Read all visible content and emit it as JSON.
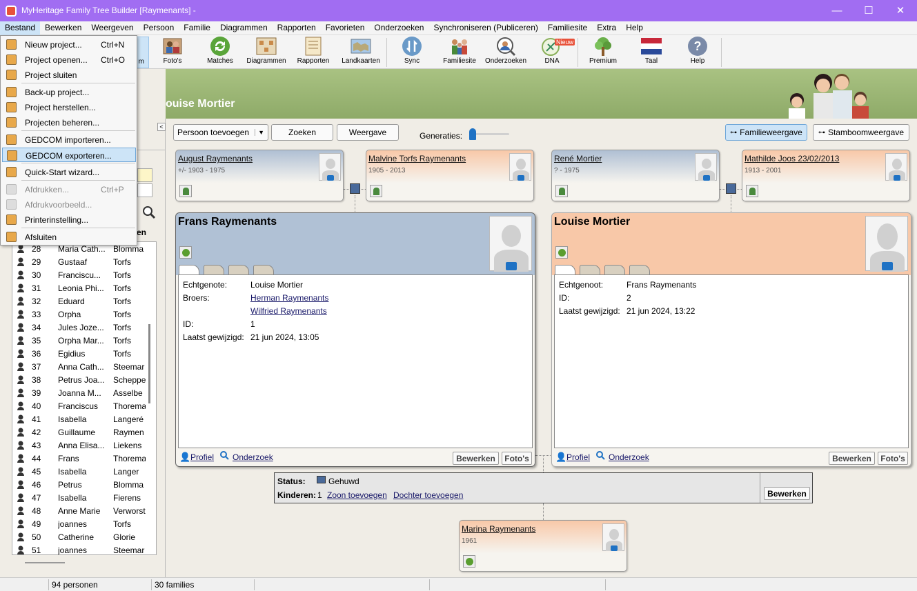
{
  "window": {
    "title": "MyHeritage Family Tree Builder [Raymenants] -",
    "minimize": "—",
    "maximize": "☐",
    "close": "✕"
  },
  "menubar": [
    "Bestand",
    "Bewerken",
    "Weergeven",
    "Persoon",
    "Familie",
    "Diagrammen",
    "Rapporten",
    "Favorieten",
    "Onderzoeken",
    "Synchroniseren (Publiceren)",
    "Familiesite",
    "Extra",
    "Help"
  ],
  "toolbar": {
    "items": [
      {
        "label": "m",
        "icon": "project-icon"
      },
      {
        "label": "Foto's",
        "icon": "photos-icon"
      },
      {
        "label": "Matches",
        "icon": "matches-icon"
      },
      {
        "label": "Diagrammen",
        "icon": "charts-icon"
      },
      {
        "label": "Rapporten",
        "icon": "reports-icon"
      },
      {
        "label": "Landkaarten",
        "icon": "maps-icon"
      },
      {
        "label": "Sync",
        "icon": "sync-icon"
      },
      {
        "label": "Familiesite",
        "icon": "familysite-icon"
      },
      {
        "label": "Onderzoeken",
        "icon": "research-icon"
      },
      {
        "label": "DNA",
        "icon": "dna-icon",
        "badge": "Nieuw"
      },
      {
        "label": "Premium",
        "icon": "premium-icon"
      },
      {
        "label": "Taal",
        "icon": "language-flag-icon"
      },
      {
        "label": "Help",
        "icon": "help-icon"
      }
    ]
  },
  "banner": {
    "name": "ouise Mortier"
  },
  "filemenu": {
    "items": [
      {
        "label": "Nieuw project...",
        "shortcut": "Ctrl+N",
        "icon": "new-project-icon",
        "disabled": false
      },
      {
        "label": "Project openen...",
        "shortcut": "Ctrl+O",
        "icon": "open-project-icon",
        "disabled": false
      },
      {
        "label": "Project sluiten",
        "shortcut": "",
        "icon": "close-project-icon",
        "disabled": false
      },
      {
        "label": "Back-up project...",
        "shortcut": "",
        "icon": "backup-icon",
        "disabled": false
      },
      {
        "label": "Project herstellen...",
        "shortcut": "",
        "icon": "restore-icon",
        "disabled": false
      },
      {
        "label": "Projecten beheren...",
        "shortcut": "",
        "icon": "manage-projects-icon",
        "disabled": false
      },
      {
        "label": "GEDCOM importeren...",
        "shortcut": "",
        "icon": "gedcom-import-icon",
        "disabled": false
      },
      {
        "label": "GEDCOM exporteren...",
        "shortcut": "",
        "icon": "gedcom-export-icon",
        "disabled": false,
        "highlighted": true
      },
      {
        "label": "Quick-Start wizard...",
        "shortcut": "",
        "icon": "wizard-icon",
        "disabled": false
      },
      {
        "label": "Afdrukken...",
        "shortcut": "Ctrl+P",
        "icon": "print-icon",
        "disabled": true
      },
      {
        "label": "Afdrukvoorbeeld...",
        "shortcut": "",
        "icon": "print-preview-icon",
        "disabled": true
      },
      {
        "label": "Printerinstelling...",
        "shortcut": "",
        "icon": "printer-setup-icon",
        "disabled": false
      },
      {
        "label": "Afsluiten",
        "shortcut": "",
        "icon": "exit-icon",
        "disabled": false
      }
    ]
  },
  "leftpanel": {
    "collapse": "<",
    "header_frag": "en",
    "rows": [
      {
        "id": "28",
        "first": "Maria Cath...",
        "last": "Blomma"
      },
      {
        "id": "29",
        "first": "Gustaaf",
        "last": "Torfs"
      },
      {
        "id": "30",
        "first": "Franciscu...",
        "last": "Torfs"
      },
      {
        "id": "31",
        "first": "Leonia Phi...",
        "last": "Torfs"
      },
      {
        "id": "32",
        "first": "Eduard",
        "last": "Torfs"
      },
      {
        "id": "33",
        "first": "Orpha",
        "last": "Torfs"
      },
      {
        "id": "34",
        "first": "Jules Joze...",
        "last": "Torfs"
      },
      {
        "id": "35",
        "first": "Orpha Mar...",
        "last": "Torfs"
      },
      {
        "id": "36",
        "first": "Egidius",
        "last": "Torfs"
      },
      {
        "id": "37",
        "first": "Anna Cath...",
        "last": "Steemar"
      },
      {
        "id": "38",
        "first": "Petrus Joa...",
        "last": "Scheppe"
      },
      {
        "id": "39",
        "first": "Joanna M...",
        "last": "Asselbe"
      },
      {
        "id": "40",
        "first": "Franciscus",
        "last": "Thorema"
      },
      {
        "id": "41",
        "first": "Isabella",
        "last": "Langeré"
      },
      {
        "id": "42",
        "first": "Guillaume",
        "last": "Raymen"
      },
      {
        "id": "43",
        "first": "Anna Elisa...",
        "last": "Liekens"
      },
      {
        "id": "44",
        "first": "Frans",
        "last": "Thorema"
      },
      {
        "id": "45",
        "first": "Isabella",
        "last": "Langer"
      },
      {
        "id": "46",
        "first": "Petrus",
        "last": "Blomma"
      },
      {
        "id": "47",
        "first": "Isabella",
        "last": "Fierens"
      },
      {
        "id": "48",
        "first": "Anne Marie",
        "last": "Verworst"
      },
      {
        "id": "49",
        "first": "joannes",
        "last": "Torfs"
      },
      {
        "id": "50",
        "first": "Catherine",
        "last": "Glorie"
      },
      {
        "id": "51",
        "first": "joannes",
        "last": "Steemar"
      }
    ]
  },
  "actionbar": {
    "add_person": "Persoon toevoegen",
    "search": "Zoeken",
    "view": "Weergave",
    "generations": "Generaties:",
    "family_view": "Familieweergave",
    "tree_view": "Stamboomweergave"
  },
  "parents": [
    {
      "name": "August Raymenants",
      "dates": "+/- 1903 - 1975"
    },
    {
      "name": "Malvine Torfs Raymenants",
      "dates": "1905 - 2013"
    },
    {
      "name": "René Mortier",
      "dates": "? - 1975"
    },
    {
      "name": "Mathilde Joos 23/02/2013",
      "dates": "1913 - 2001"
    }
  ],
  "husband": {
    "name": "Frans Raymenants",
    "fields": [
      {
        "label": "Echtgenote:",
        "value": "Louise Mortier",
        "link": false
      },
      {
        "label": "Broers:",
        "value": "Herman Raymenants",
        "link": true
      },
      {
        "label": "",
        "value": "Wilfried Raymenants",
        "link": true
      },
      {
        "label": "ID:",
        "value": "1",
        "link": false
      },
      {
        "label": "Laatst gewijzigd:",
        "value": "21 jun 2024, 13:05",
        "link": false
      }
    ]
  },
  "wife": {
    "name": "Louise Mortier",
    "fields": [
      {
        "label": "Echtgenoot:",
        "value": "Frans Raymenants",
        "link": false
      },
      {
        "label": "ID:",
        "value": "2",
        "link": false
      },
      {
        "label": "Laatst gewijzigd:",
        "value": "21 jun 2024, 13:22",
        "link": false
      }
    ]
  },
  "cardlinks": {
    "profile": "Profiel",
    "research": "Onderzoek",
    "edit": "Bewerken",
    "photos": "Foto's"
  },
  "family": {
    "status_label": "Status:",
    "status_value": "Gehuwd",
    "children_label": "Kinderen:",
    "children_count": "1",
    "add_son": "Zoon toevoegen",
    "add_daughter": "Dochter toevoegen",
    "edit": "Bewerken"
  },
  "child": {
    "name": "Marina Raymenants",
    "dates": "1961"
  },
  "statusbar": {
    "persons": "94 personen",
    "families": "30 families"
  }
}
